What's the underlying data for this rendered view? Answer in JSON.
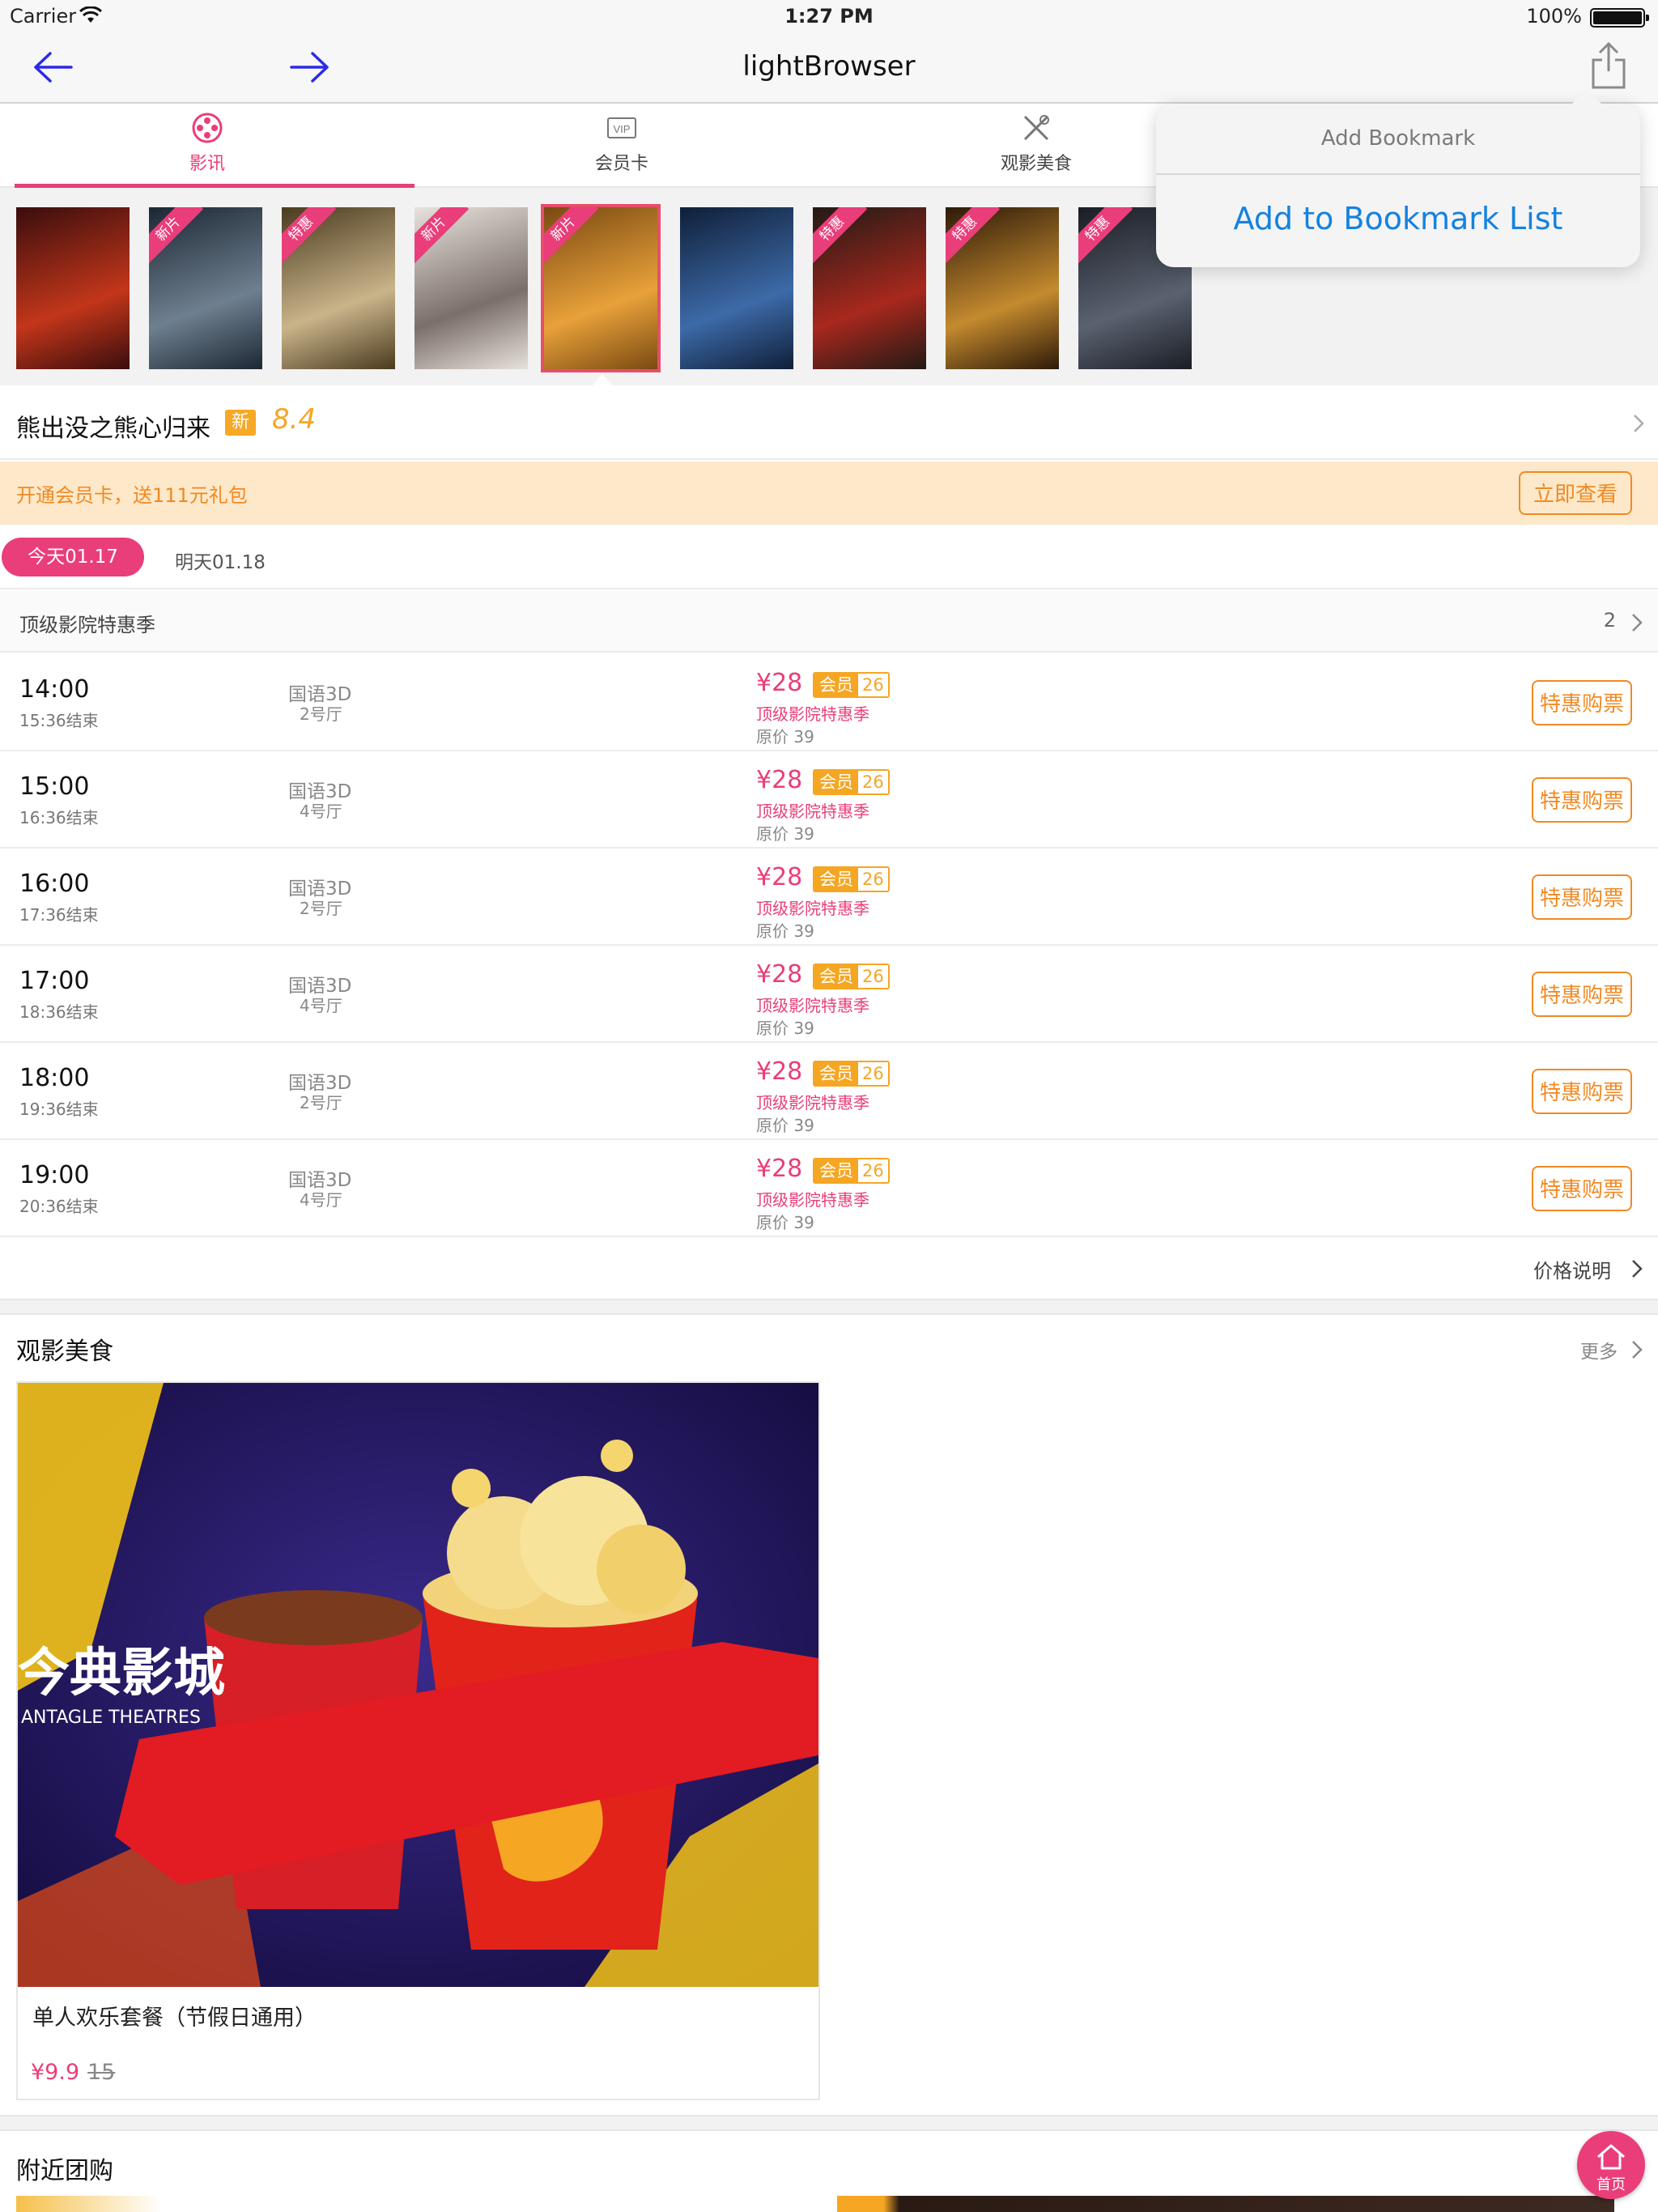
{
  "status_bar": {
    "carrier": "Carrier",
    "time": "1:27 PM",
    "battery": "100%"
  },
  "navbar": {
    "title": "lightBrowser"
  },
  "tabs": [
    {
      "label": "影讯",
      "icon": "film-reel-icon"
    },
    {
      "label": "会员卡",
      "icon": "vip-card-icon"
    },
    {
      "label": "观影美食",
      "icon": "utensils-icon"
    }
  ],
  "popover": {
    "title": "Add Bookmark",
    "action": "Add to Bookmark List"
  },
  "posters": [
    {
      "badge": "",
      "colors": [
        "#3a0d0d",
        "#c2361a"
      ]
    },
    {
      "badge": "新片",
      "colors": [
        "#1c2733",
        "#6e7f8f"
      ]
    },
    {
      "badge": "特惠",
      "colors": [
        "#4a3a1f",
        "#c9b48a"
      ]
    },
    {
      "badge": "新片",
      "colors": [
        "#e8e2dc",
        "#7b6f6a"
      ]
    },
    {
      "badge": "新片",
      "colors": [
        "#7a4a12",
        "#e8a13a"
      ]
    },
    {
      "badge": "",
      "colors": [
        "#0f1f38",
        "#3d6aa8"
      ]
    },
    {
      "badge": "特惠",
      "colors": [
        "#221a16",
        "#a8281d"
      ]
    },
    {
      "badge": "特惠",
      "colors": [
        "#2d1a09",
        "#c48a2e"
      ]
    },
    {
      "badge": "特惠",
      "colors": [
        "#1a1d24",
        "#5a6270"
      ]
    }
  ],
  "movie": {
    "name": "熊出没之熊心归来",
    "new_tag": "新",
    "score": "8.4"
  },
  "promo": {
    "text": "开通会员卡，送111元礼包",
    "button": "立即查看"
  },
  "dates": {
    "today": "今天01.17",
    "tomorrow": "明天01.18"
  },
  "section": {
    "title": "顶级影院特惠季",
    "count": "2"
  },
  "showtimes": [
    {
      "start": "14:00",
      "end": "15:36结束",
      "lang": "国语3D",
      "hall": "2号厅",
      "price": "¥28",
      "member_label": "会员",
      "member_price": "26",
      "promo": "顶级影院特惠季",
      "original": "原价  39",
      "button": "特惠购票"
    },
    {
      "start": "15:00",
      "end": "16:36结束",
      "lang": "国语3D",
      "hall": "4号厅",
      "price": "¥28",
      "member_label": "会员",
      "member_price": "26",
      "promo": "顶级影院特惠季",
      "original": "原价  39",
      "button": "特惠购票"
    },
    {
      "start": "16:00",
      "end": "17:36结束",
      "lang": "国语3D",
      "hall": "2号厅",
      "price": "¥28",
      "member_label": "会员",
      "member_price": "26",
      "promo": "顶级影院特惠季",
      "original": "原价  39",
      "button": "特惠购票"
    },
    {
      "start": "17:00",
      "end": "18:36结束",
      "lang": "国语3D",
      "hall": "4号厅",
      "price": "¥28",
      "member_label": "会员",
      "member_price": "26",
      "promo": "顶级影院特惠季",
      "original": "原价  39",
      "button": "特惠购票"
    },
    {
      "start": "18:00",
      "end": "19:36结束",
      "lang": "国语3D",
      "hall": "2号厅",
      "price": "¥28",
      "member_label": "会员",
      "member_price": "26",
      "promo": "顶级影院特惠季",
      "original": "原价  39",
      "button": "特惠购票"
    },
    {
      "start": "19:00",
      "end": "20:36结束",
      "lang": "国语3D",
      "hall": "4号厅",
      "price": "¥28",
      "member_label": "会员",
      "member_price": "26",
      "promo": "顶级影院特惠季",
      "original": "原价  39",
      "button": "特惠购票"
    }
  ],
  "price_note": "价格说明",
  "food": {
    "title": "观影美食",
    "more": "更多",
    "item": {
      "name": "单人欢乐套餐（节假日通用）",
      "price": "¥9.9",
      "old_price": "15",
      "image_text": "今典影城",
      "image_subtext": "ANTAGLE THEATRES"
    }
  },
  "nearby": {
    "title": "附近团购"
  },
  "home_button": {
    "label": "首页",
    "icon": "home-icon"
  },
  "colors": {
    "accent": "#e93e7a",
    "orange": "#f08a24",
    "link_blue": "#1582e0"
  }
}
